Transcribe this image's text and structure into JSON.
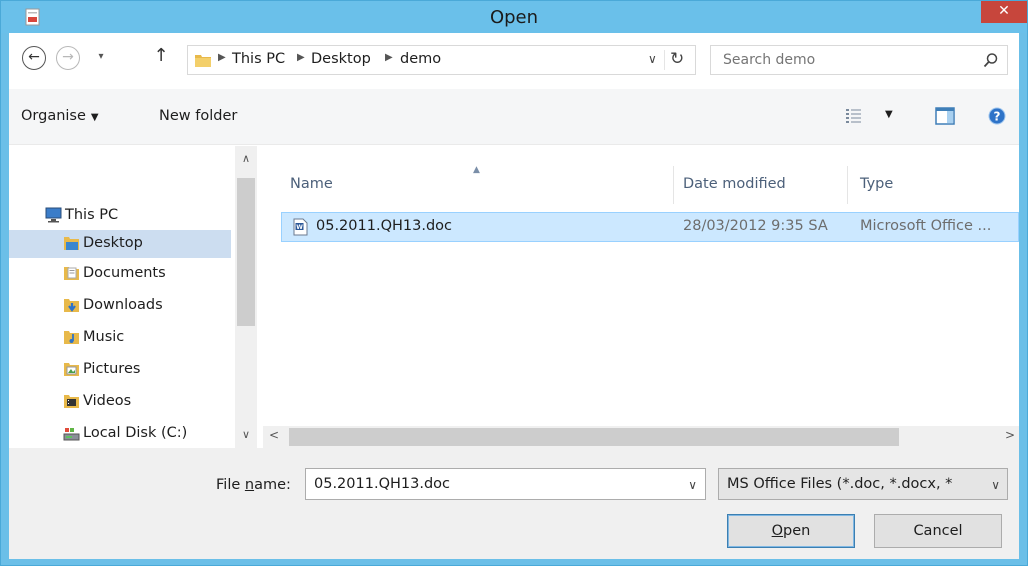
{
  "window": {
    "title": "Open",
    "close_glyph": "✕"
  },
  "nav": {
    "back_icon": "back-arrow-icon",
    "forward_icon": "forward-arrow-icon",
    "recent_caret": "▾",
    "up_glyph": "↑"
  },
  "address": {
    "crumbs": [
      "This PC",
      "Desktop",
      "demo"
    ],
    "separator": "▶",
    "dropdown_glyph": "∨",
    "refresh_glyph": "↻"
  },
  "search": {
    "placeholder": "Search demo"
  },
  "toolbar": {
    "organise_label": "Organise",
    "organise_caret": "▼",
    "new_folder_label": "New folder",
    "views_caret": "▼"
  },
  "sidebar": {
    "items": [
      {
        "label": "This PC",
        "icon": "computer-icon"
      },
      {
        "label": "Desktop",
        "icon": "desktop-folder-icon",
        "selected": true
      },
      {
        "label": "Documents",
        "icon": "documents-folder-icon"
      },
      {
        "label": "Downloads",
        "icon": "downloads-folder-icon"
      },
      {
        "label": "Music",
        "icon": "music-folder-icon"
      },
      {
        "label": "Pictures",
        "icon": "pictures-folder-icon"
      },
      {
        "label": "Videos",
        "icon": "videos-folder-icon"
      },
      {
        "label": "Local Disk (C:)",
        "icon": "disk-drive-icon"
      }
    ],
    "scroll_up": "∧",
    "scroll_down": "∨"
  },
  "files": {
    "columns": [
      "Name",
      "Date modified",
      "Type"
    ],
    "rows": [
      {
        "name": "05.2011.QH13.doc",
        "date": "28/03/2012 9:35 SA",
        "type": "Microsoft Office ...",
        "icon": "word-document-icon"
      }
    ],
    "scroll_left": "<",
    "scroll_right": ">"
  },
  "footer": {
    "filename_label_pre": "File ",
    "filename_label_u": "n",
    "filename_label_post": "ame:",
    "filename_value": "05.2011.QH13.doc",
    "filter_value": "MS Office Files (*.doc, *.docx, *",
    "open_u": "O",
    "open_rest": "pen",
    "cancel_label": "Cancel",
    "dropdown_glyph": "∨"
  },
  "colors": {
    "titlebar": "#6ac0ea",
    "close": "#c7463c",
    "selection": "#cce8ff"
  }
}
